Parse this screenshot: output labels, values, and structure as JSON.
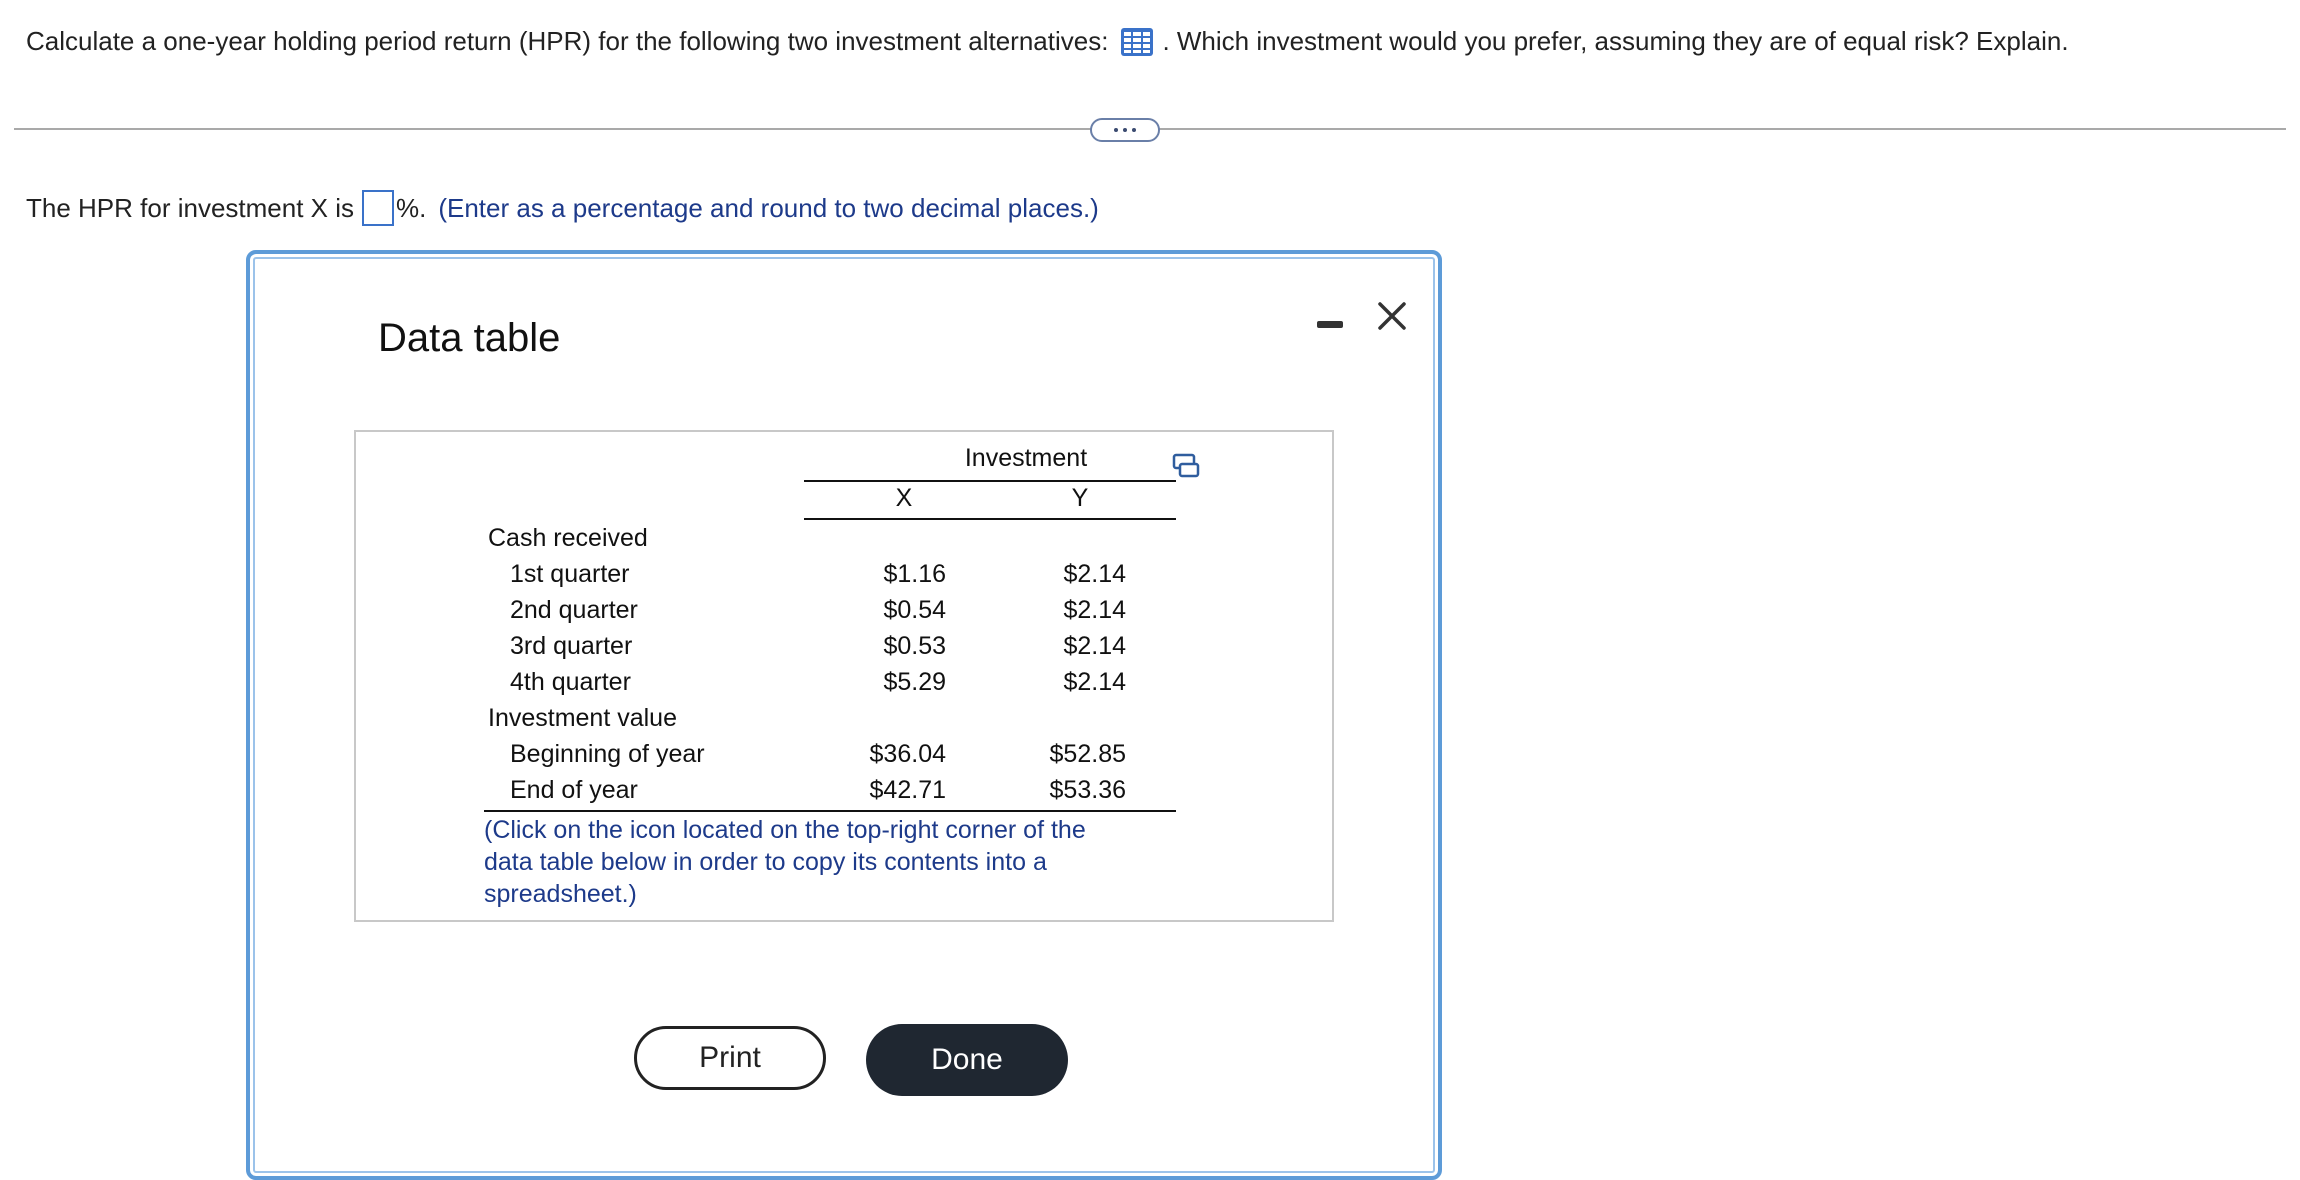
{
  "question": {
    "text_before": "Calculate a one-year holding period return (HPR) for the following two investment alternatives:",
    "text_after": ". Which investment would you prefer, assuming they are of equal risk? Explain.",
    "icon": "data-table-grid-icon"
  },
  "answer": {
    "prefix": "The HPR for investment X is",
    "input_value": "",
    "suffix": "%.",
    "hint": "(Enter as a percentage and round to two decimal places.)"
  },
  "modal": {
    "title": "Data table",
    "table": {
      "group_header": "Investment",
      "columns": [
        "X",
        "Y"
      ],
      "sections": [
        {
          "label": "Cash received",
          "rows": [
            {
              "label": "1st quarter",
              "x": "$1.16",
              "y": "$2.14"
            },
            {
              "label": "2nd quarter",
              "x": "$0.54",
              "y": "$2.14"
            },
            {
              "label": "3rd quarter",
              "x": "$0.53",
              "y": "$2.14"
            },
            {
              "label": "4th quarter",
              "x": "$5.29",
              "y": "$2.14"
            }
          ]
        },
        {
          "label": "Investment value",
          "rows": [
            {
              "label": "Beginning of year",
              "x": "$36.04",
              "y": "$52.85"
            },
            {
              "label": "End of year",
              "x": "$42.71",
              "y": "$53.36"
            }
          ]
        }
      ],
      "footnote": "(Click on the icon located on the top-right corner of the data table below in order to copy its contents into a spreadsheet.)"
    },
    "print_label": "Print",
    "done_label": "Done"
  },
  "colors": {
    "accent_blue": "#3a72c9",
    "hint_text": "#1d3a8a",
    "modal_border": "#5d9bd8",
    "done_button": "#1f2731"
  }
}
